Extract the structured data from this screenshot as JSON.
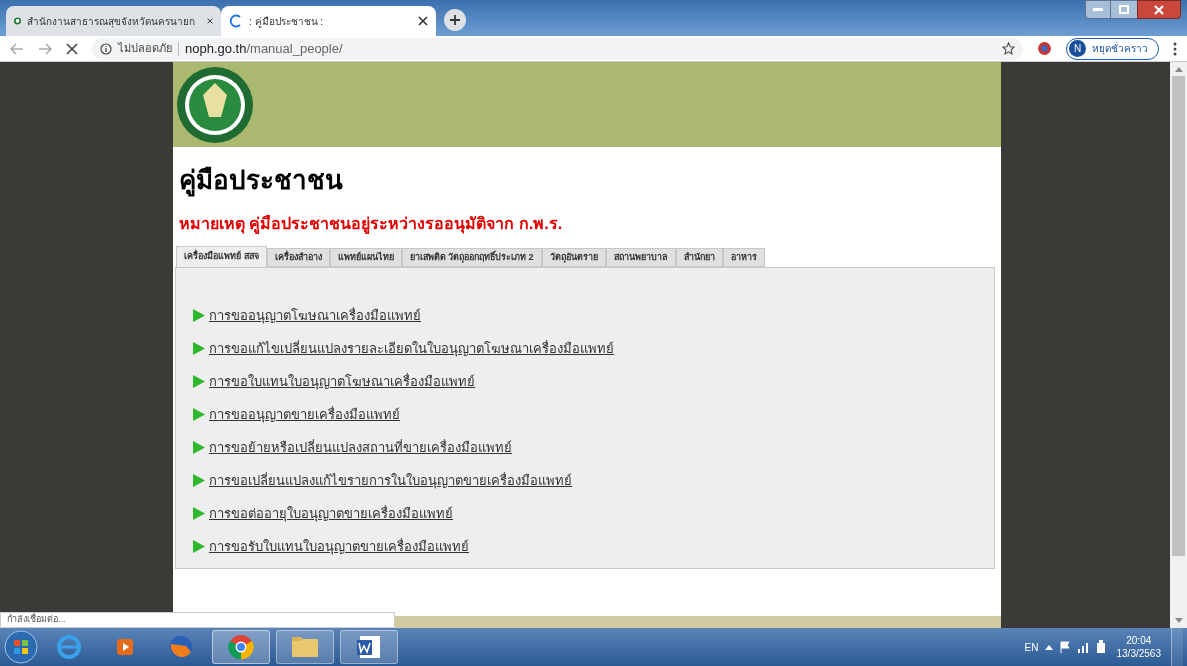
{
  "browser": {
    "tabs": [
      {
        "title": "สำนักงานสาธารณสุขจังหวัดนครนายก",
        "selected": false,
        "loading": false
      },
      {
        "title": ": คู่มือประชาชน :",
        "selected": true,
        "loading": true
      }
    ],
    "security_label": "ไม่ปลอดภัย",
    "url_host": "noph.go.th",
    "url_path": "/manual_people/",
    "profile_initial": "N",
    "profile_label": "หยุดชั่วคราว",
    "status_text": "กำลังเชื่อมต่อ..."
  },
  "page": {
    "title": "คู่มือประชาชน",
    "note": "หมายเหตุ คู่มือประชาชนอยู่ระหว่างรออนุมัติจาก ก.พ.ร.",
    "tabs": [
      {
        "label": "เครื่องมือแพทย์ สสจ",
        "selected": true
      },
      {
        "label": "เครื่องสำอาง",
        "selected": false
      },
      {
        "label": "แพทย์แผนไทย",
        "selected": false
      },
      {
        "label": "ยาเสพติด วัตถุออกฤทธิ์ประเภท 2",
        "selected": false
      },
      {
        "label": "วัตถุอันตราย",
        "selected": false
      },
      {
        "label": "สถานพยาบาล",
        "selected": false
      },
      {
        "label": "สำนักยา",
        "selected": false
      },
      {
        "label": "อาหาร",
        "selected": false
      }
    ],
    "links": [
      "การขออนุญาตโฆษณาเครื่องมือแพทย์",
      "การขอแก้ไขเปลี่ยนแปลงรายละเอียดในใบอนุญาตโฆษณาเครื่องมือแพทย์",
      "การขอใบแทนใบอนุญาตโฆษณาเครื่องมือแพทย์",
      "การขออนุญาตขายเครื่องมือแพทย์",
      "การขอย้ายหรือเปลี่ยนแปลงสถานที่ขายเครื่องมือแพทย์",
      "การขอเปลี่ยนแปลงแก้ไขรายการในใบอนุญาตขายเครื่องมือแพทย์",
      "การขอต่ออายุใบอนุญาตขายเครื่องมือแพทย์",
      "การขอรับใบแทนใบอนุญาตขายเครื่องมือแพทย์"
    ]
  },
  "taskbar": {
    "language": "EN",
    "time": "20:04",
    "date": "13/3/2563"
  }
}
